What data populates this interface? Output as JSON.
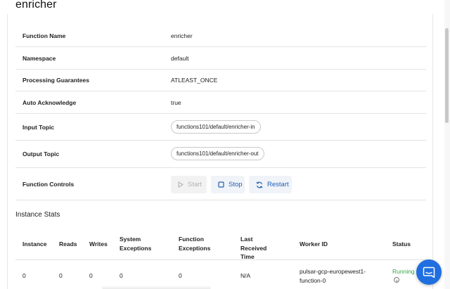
{
  "page": {
    "title": "enricher"
  },
  "details": [
    {
      "label": "Function Name",
      "value": "enricher"
    },
    {
      "label": "Namespace",
      "value": "default"
    },
    {
      "label": "Processing Guarantees",
      "value": "ATLEAST_ONCE"
    },
    {
      "label": "Auto Acknowledge",
      "value": "true"
    },
    {
      "label": "Input Topic",
      "chip": "functions101/default/enricher-in"
    },
    {
      "label": "Output Topic",
      "chip": "functions101/default/enricher-out"
    },
    {
      "label": "Function Controls"
    }
  ],
  "controls": {
    "start_label": "Start",
    "stop_label": "Stop",
    "restart_label": "Restart"
  },
  "instance_stats": {
    "title": "Instance Stats",
    "columns": [
      "Instance",
      "Reads",
      "Writes",
      "System Exceptions",
      "Function Exceptions",
      "Last Received Time",
      "Worker ID",
      "Status"
    ],
    "rows": [
      {
        "instance": "0",
        "reads": "0",
        "writes": "0",
        "system_exceptions": "0",
        "function_exceptions": "0",
        "last_received_time": "N/A",
        "worker_id": "pulsar-gcp-europewest1-function-0",
        "status": "Running"
      }
    ]
  },
  "colors": {
    "accent": "#1f5fb8",
    "running": "#3aa14a",
    "fab": "#1f6fe0"
  },
  "icons": [
    "play-icon",
    "stop-icon",
    "restart-icon",
    "info-icon",
    "chat-icon"
  ]
}
